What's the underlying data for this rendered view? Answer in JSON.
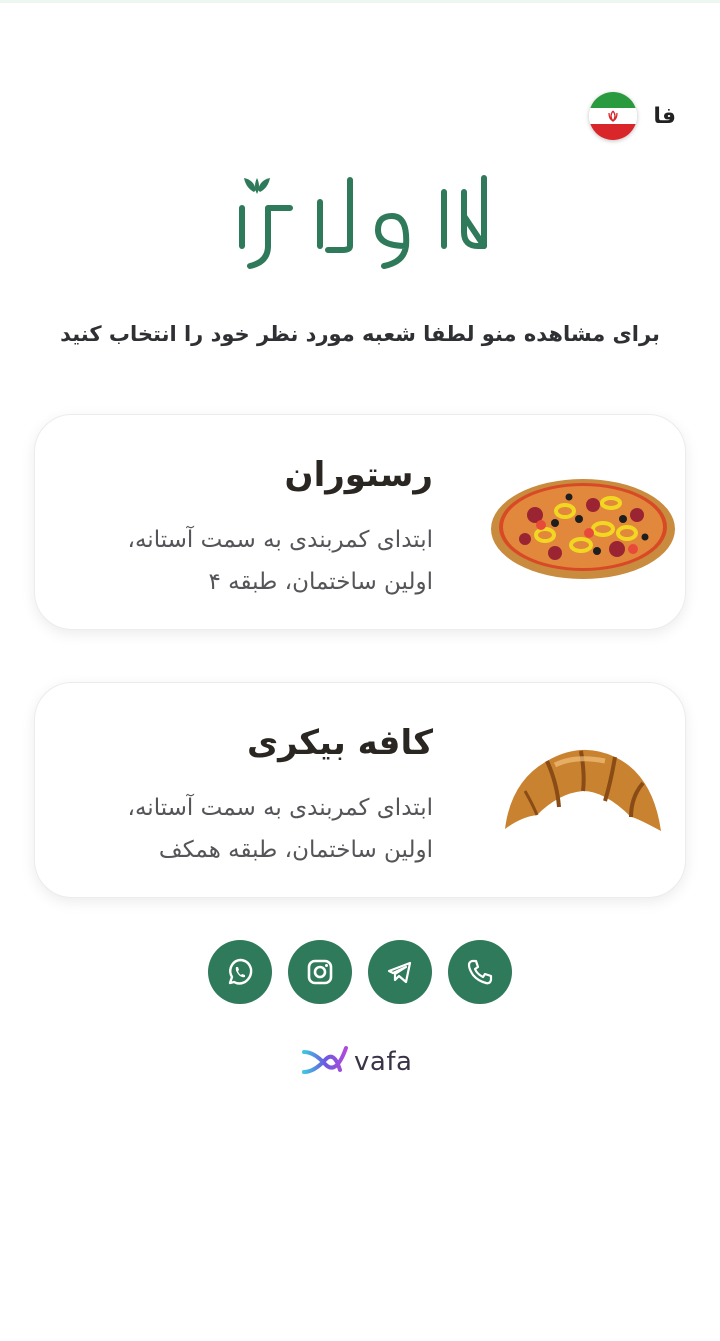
{
  "header": {
    "language_label": "فا",
    "flag_icon": "iran-flag-icon"
  },
  "logo": {
    "text": "کارو لاژ",
    "color": "#2e7a5a"
  },
  "subtitle": "برای مشاهده منو لطفا شعبه مورد نظر خود را انتخاب کنید",
  "branches": [
    {
      "title": "رستوران",
      "address_line1": "ابتدای کمربندی به سمت آستانه،",
      "address_line2": "اولین ساختمان، طبقه ۴",
      "image": "pizza"
    },
    {
      "title": "کافه بیکری",
      "address_line1": "ابتدای کمربندی به سمت آستانه،",
      "address_line2": "اولین ساختمان، طبقه همکف",
      "image": "croissant"
    }
  ],
  "socials": [
    "whatsapp-icon",
    "instagram-icon",
    "telegram-icon",
    "phone-icon"
  ],
  "footer": {
    "brand": "vafa"
  },
  "colors": {
    "accent": "#2e7a5a",
    "card_border": "#ececec",
    "text_dark": "#2a2622"
  }
}
